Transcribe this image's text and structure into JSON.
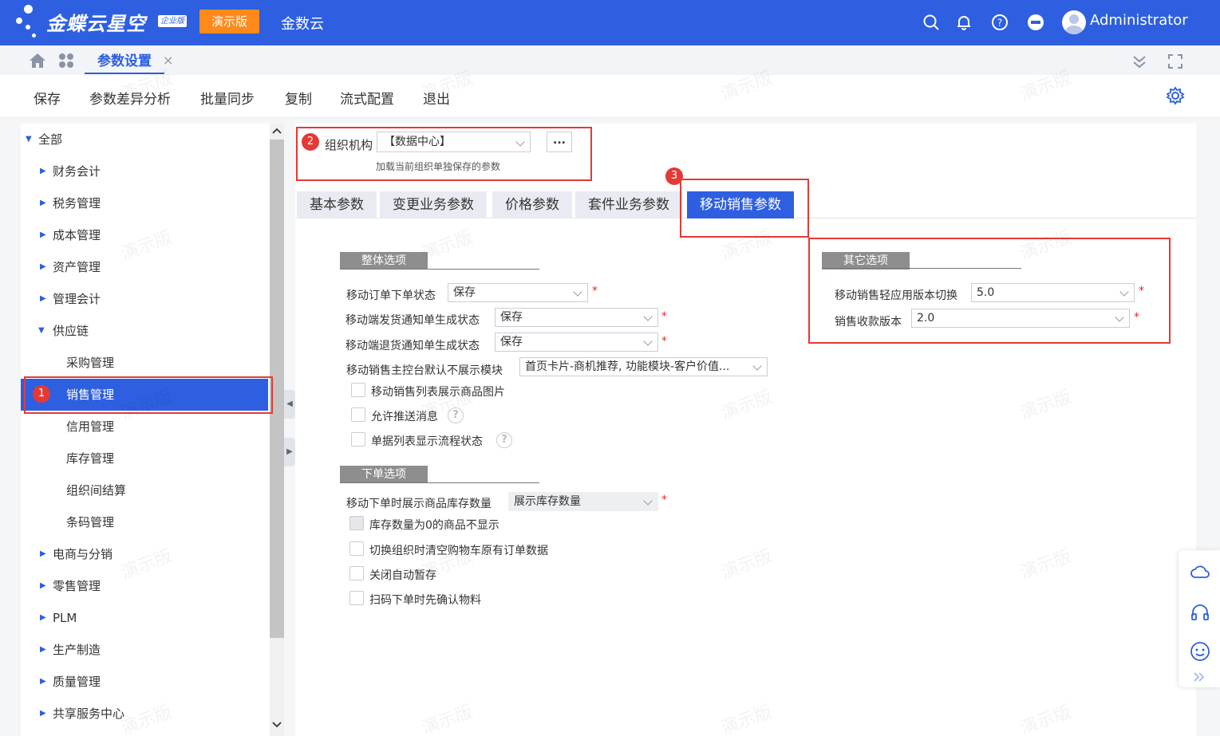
{
  "header": {
    "brand": "金蝶云星空",
    "edition_badge": "企业版",
    "demo_label": "演示版",
    "cloud_name": "金数云",
    "username": "Administrator",
    "brand_color": "#2d5fe0"
  },
  "tabbar": {
    "active_tab": "参数设置",
    "close": "×"
  },
  "toolbar": {
    "save": "保存",
    "diff": "参数差异分析",
    "sync": "批量同步",
    "copy": "复制",
    "flow": "流式配置",
    "exit": "退出"
  },
  "tree": {
    "root": "全部",
    "items": [
      "财务会计",
      "税务管理",
      "成本管理",
      "资产管理",
      "管理会计",
      "供应链",
      "采购管理",
      "销售管理",
      "信用管理",
      "库存管理",
      "组织间结算",
      "条码管理",
      "电商与分销",
      "零售管理",
      "PLM",
      "生产制造",
      "质量管理",
      "共享服务中心"
    ]
  },
  "org": {
    "label": "组织机构",
    "value": "【数据中心】",
    "more": "...",
    "hint": "加载当前组织单独保存的参数"
  },
  "tabs": [
    "基本参数",
    "变更业务参数",
    "价格参数",
    "套件业务参数",
    "移动销售参数"
  ],
  "overall": {
    "title": "整体选项",
    "f1_label": "移动订单下单状态",
    "f1_value": "保存",
    "f2_label": "移动端发货通知单生成状态",
    "f2_value": "保存",
    "f3_label": "移动端退货通知单生成状态",
    "f3_value": "保存",
    "f4_label": "移动销售主控台默认不展示模块",
    "f4_value": "首页卡片-商机推荐, 功能模块-客户价值...",
    "cb1": "移动销售列表展示商品图片",
    "cb2": "允许推送消息",
    "cb3": "单据列表显示流程状态",
    "required": "*",
    "help": "?"
  },
  "order": {
    "title": "下单选项",
    "f1_label": "移动下单时展示商品库存数量",
    "f1_value": "展示库存数量",
    "cb1": "库存数量为0的商品不显示",
    "cb2": "切换组织时清空购物车原有订单数据",
    "cb3": "关闭自动暂存",
    "cb4": "扫码下单时先确认物料"
  },
  "other": {
    "title": "其它选项",
    "f1_label": "移动销售轻应用版本切换",
    "f1_value": "5.0",
    "f2_label": "销售收款版本",
    "f2_value": "2.0"
  },
  "markers": [
    "1",
    "2",
    "3"
  ],
  "watermark": "演示版"
}
